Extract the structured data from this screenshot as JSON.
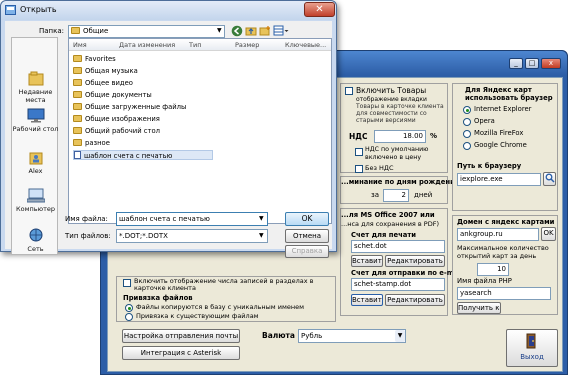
{
  "settings_window": {
    "top_check_label": "Включить Товары",
    "note_tabs": "отображение вкладки",
    "note_goods": "Товары в карточке клиента для совместимости со старыми версиями",
    "nds_label": "НДС",
    "nds_value": "18.00",
    "nds_unit": "%",
    "nds_default_label": "НДС по умолчанию включено в цену",
    "no_nds_label": "Без НДС",
    "birthday_label": "...минание по дням рождения",
    "birthday_prefix": "за",
    "birthday_value": "2",
    "birthday_suffix": "дней",
    "office_label1": "...ля MS Office 2007 или",
    "office_label2": "...нса для сохранения в PDF)",
    "print_invoice_label": "Счет для печати",
    "print_invoice_value": "schet.dot",
    "insert_button": "Вставить",
    "edit_button": "Редактировать",
    "email_invoice_label": "Счет для отправки по e-mail",
    "email_invoice_value": "schet-stamp.dot",
    "insert_button2": "Вставить",
    "edit_button2": "Редактировать",
    "records_check_label": "Включить отображение числа записей в разделах в карточке клиента",
    "attach_label": "Привязка файлов",
    "attach_opt1": "Файлы копируются в базу с уникальным именем",
    "attach_opt2": "Привязка к существующим файлам",
    "mail_settings_button": "Настройка отправления почты",
    "asterisk_button": "Интеграция с Asterisk",
    "currency_label": "Валюта",
    "currency_value": "Рубль",
    "yandex_browser_label": "Для Яндекс карт использовать браузер",
    "browsers": [
      "Internet Explorer",
      "Opera",
      "Mozilla FireFox",
      "Google Chrome"
    ],
    "browser_path_label": "Путь к браузеру",
    "browser_path_value": "iexplore.exe",
    "yandex_domain_label": "Домен с яндекс картами",
    "yandex_domain_value": "ankgroup.ru",
    "ok_small": "OK",
    "max_cards_label": "Максимальное количество открытий карт за день",
    "max_cards_value": "10",
    "php_label": "Имя файла PHP",
    "php_value": "yasearch",
    "get_code_button": "Получить код",
    "exit_button": "Выход",
    "winbtn_min": "_",
    "winbtn_max": "□",
    "winbtn_close": "x"
  },
  "dialog": {
    "title": "Открыть",
    "close_glyph": "✕",
    "folder_label": "Папка:",
    "folder_value": "Общие",
    "places": [
      "Недавние места",
      "Рабочий стол",
      "Alex",
      "Компьютер",
      "Сеть"
    ],
    "columns": [
      "Имя",
      "Дата изменения",
      "Тип",
      "Размер",
      "Ключевые..."
    ],
    "files": [
      {
        "name": "Favorites",
        "kind": "folder"
      },
      {
        "name": "Общая музыка",
        "kind": "folder"
      },
      {
        "name": "Общее видео",
        "kind": "folder"
      },
      {
        "name": "Общие документы",
        "kind": "folder"
      },
      {
        "name": "Общие загруженные файлы",
        "kind": "folder"
      },
      {
        "name": "Общие изображения",
        "kind": "folder"
      },
      {
        "name": "Общий рабочий стол",
        "kind": "folder"
      },
      {
        "name": "разное",
        "kind": "folder"
      },
      {
        "name": "шаблон счета с печатью",
        "kind": "doc"
      }
    ],
    "filename_label": "Имя файла:",
    "filename_value": "шаблон счета с печатью",
    "filetype_label": "Тип файлов:",
    "filetype_value": "*.DOT;*.DOTX",
    "ok_button": "OK",
    "cancel_button": "Отмена",
    "help_button": "Справка"
  }
}
